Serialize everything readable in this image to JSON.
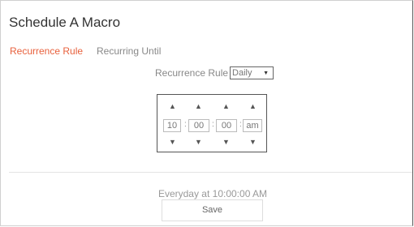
{
  "dialog": {
    "title": "Schedule A Macro"
  },
  "tabs": [
    {
      "label": "Recurrence Rule",
      "active": true
    },
    {
      "label": "Recurring Until",
      "active": false
    }
  ],
  "recurrence": {
    "label": "Recurrence Rule",
    "selected": "Daily"
  },
  "time": {
    "hour": "10",
    "minute": "00",
    "second": "00",
    "meridiem": "am",
    "separator": ":",
    "up_glyph": "▲",
    "down_glyph": "▼"
  },
  "summary": "Everyday at 10:00:00 AM",
  "actions": {
    "save_label": "Save"
  },
  "colors": {
    "accent": "#e8603c",
    "muted": "#888888"
  }
}
